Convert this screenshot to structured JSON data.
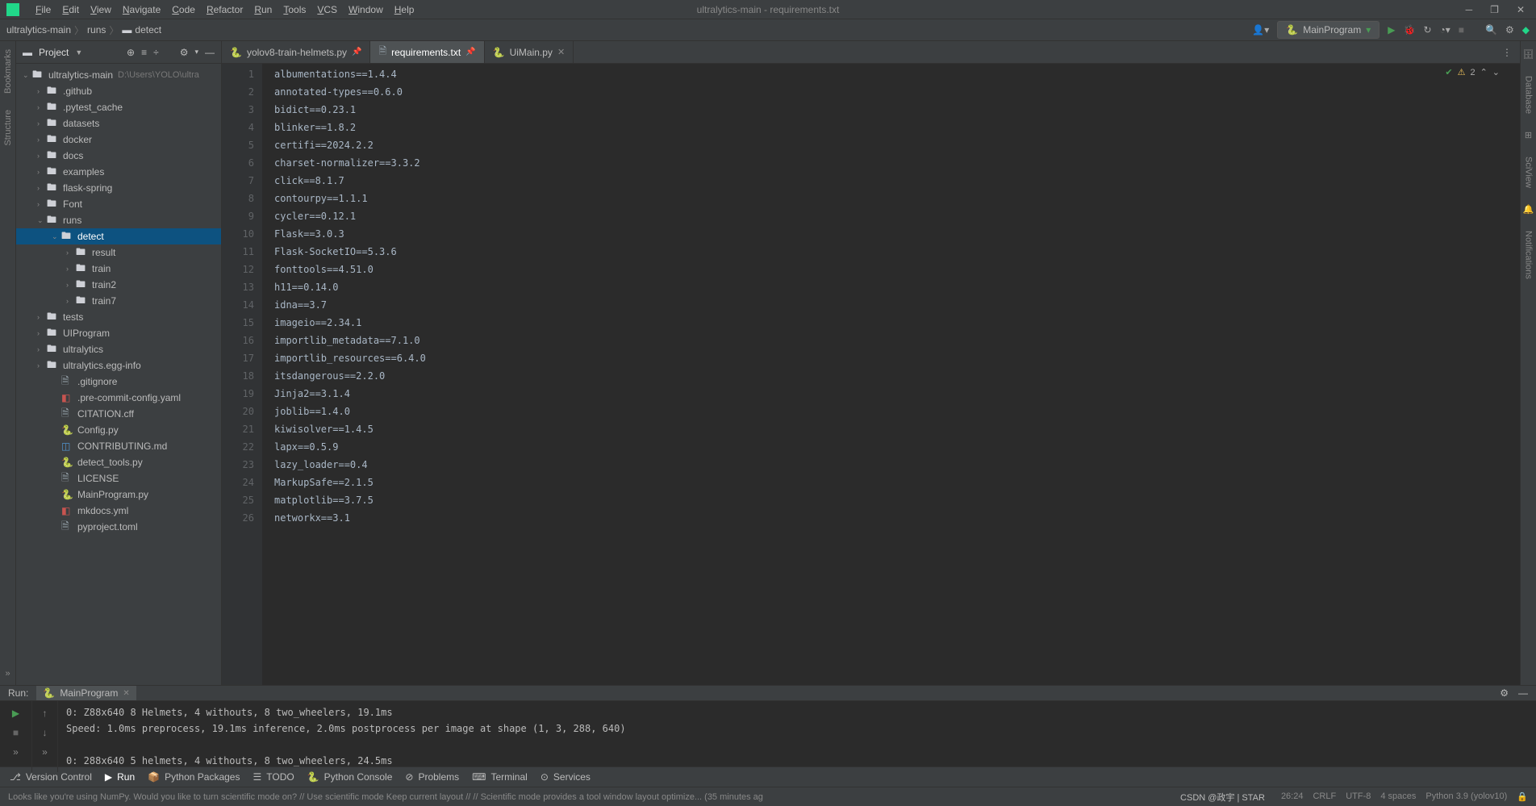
{
  "window": {
    "title": "ultralytics-main - requirements.txt"
  },
  "menu": [
    "File",
    "Edit",
    "View",
    "Navigate",
    "Code",
    "Refactor",
    "Run",
    "Tools",
    "VCS",
    "Window",
    "Help"
  ],
  "breadcrumb": [
    "ultralytics-main",
    "runs",
    "detect"
  ],
  "runConfig": "MainProgram",
  "projectPanel": {
    "label": "Project"
  },
  "tree": [
    {
      "depth": 0,
      "arrow": "v",
      "type": "folder",
      "name": "ultralytics-main",
      "path": "D:\\Users\\YOLO\\ultra"
    },
    {
      "depth": 1,
      "arrow": ">",
      "type": "folder",
      "name": ".github"
    },
    {
      "depth": 1,
      "arrow": ">",
      "type": "folder",
      "name": ".pytest_cache"
    },
    {
      "depth": 1,
      "arrow": ">",
      "type": "folder",
      "name": "datasets"
    },
    {
      "depth": 1,
      "arrow": ">",
      "type": "folder",
      "name": "docker"
    },
    {
      "depth": 1,
      "arrow": ">",
      "type": "folder",
      "name": "docs"
    },
    {
      "depth": 1,
      "arrow": ">",
      "type": "folder",
      "name": "examples"
    },
    {
      "depth": 1,
      "arrow": ">",
      "type": "folder",
      "name": "flask-spring"
    },
    {
      "depth": 1,
      "arrow": ">",
      "type": "folder",
      "name": "Font"
    },
    {
      "depth": 1,
      "arrow": "v",
      "type": "folder",
      "name": "runs"
    },
    {
      "depth": 2,
      "arrow": "v",
      "type": "folder",
      "name": "detect",
      "selected": true
    },
    {
      "depth": 3,
      "arrow": ">",
      "type": "folder",
      "name": "result"
    },
    {
      "depth": 3,
      "arrow": ">",
      "type": "folder",
      "name": "train"
    },
    {
      "depth": 3,
      "arrow": ">",
      "type": "folder",
      "name": "train2"
    },
    {
      "depth": 3,
      "arrow": ">",
      "type": "folder",
      "name": "train7"
    },
    {
      "depth": 1,
      "arrow": ">",
      "type": "folder",
      "name": "tests"
    },
    {
      "depth": 1,
      "arrow": ">",
      "type": "folder",
      "name": "UIProgram"
    },
    {
      "depth": 1,
      "arrow": ">",
      "type": "folder",
      "name": "ultralytics"
    },
    {
      "depth": 1,
      "arrow": ">",
      "type": "folder",
      "name": "ultralytics.egg-info"
    },
    {
      "depth": 2,
      "arrow": "",
      "type": "file",
      "name": ".gitignore",
      "icon": "txt"
    },
    {
      "depth": 2,
      "arrow": "",
      "type": "file",
      "name": ".pre-commit-config.yaml",
      "icon": "yaml"
    },
    {
      "depth": 2,
      "arrow": "",
      "type": "file",
      "name": "CITATION.cff",
      "icon": "txt"
    },
    {
      "depth": 2,
      "arrow": "",
      "type": "file",
      "name": "Config.py",
      "icon": "py"
    },
    {
      "depth": 2,
      "arrow": "",
      "type": "file",
      "name": "CONTRIBUTING.md",
      "icon": "md"
    },
    {
      "depth": 2,
      "arrow": "",
      "type": "file",
      "name": "detect_tools.py",
      "icon": "py"
    },
    {
      "depth": 2,
      "arrow": "",
      "type": "file",
      "name": "LICENSE",
      "icon": "txt"
    },
    {
      "depth": 2,
      "arrow": "",
      "type": "file",
      "name": "MainProgram.py",
      "icon": "py"
    },
    {
      "depth": 2,
      "arrow": "",
      "type": "file",
      "name": "mkdocs.yml",
      "icon": "yaml"
    },
    {
      "depth": 2,
      "arrow": "",
      "type": "file",
      "name": "pyproject.toml",
      "icon": "txt"
    }
  ],
  "tabs": [
    {
      "name": "yolov8-train-helmets.py",
      "icon": "py",
      "active": false,
      "pinned": true
    },
    {
      "name": "requirements.txt",
      "icon": "txt",
      "active": true,
      "pinned": true
    },
    {
      "name": "UiMain.py",
      "icon": "py",
      "active": false,
      "pinned": false
    }
  ],
  "editorWarnings": "2",
  "code": [
    "albumentations==1.4.4",
    "annotated-types==0.6.0",
    "bidict==0.23.1",
    "blinker==1.8.2",
    "certifi==2024.2.2",
    "charset-normalizer==3.3.2",
    "click==8.1.7",
    "contourpy==1.1.1",
    "cycler==0.12.1",
    "Flask==3.0.3",
    "Flask-SocketIO==5.3.6",
    "fonttools==4.51.0",
    "h11==0.14.0",
    "idna==3.7",
    "imageio==2.34.1",
    "importlib_metadata==7.1.0",
    "importlib_resources==6.4.0",
    "itsdangerous==2.2.0",
    "Jinja2==3.1.4",
    "joblib==1.4.0",
    "kiwisolver==1.4.5",
    "lapx==0.5.9",
    "lazy_loader==0.4",
    "MarkupSafe==2.1.5",
    "matplotlib==3.7.5",
    "networkx==3.1"
  ],
  "runPanel": {
    "label": "Run:",
    "tab": "MainProgram",
    "output": [
      "0: Z88x640 8 Helmets, 4 withouts, 8 two_wheelers, 19.1ms",
      "Speed: 1.0ms preprocess, 19.1ms inference, 2.0ms postprocess per image at shape (1, 3, 288, 640)",
      "",
      "0: 288x640 5 helmets, 4 withouts, 8 two_wheelers, 24.5ms"
    ]
  },
  "bottomToolbar": [
    {
      "icon": "vcs",
      "label": "Version Control"
    },
    {
      "icon": "run",
      "label": "Run",
      "active": true
    },
    {
      "icon": "pkg",
      "label": "Python Packages"
    },
    {
      "icon": "todo",
      "label": "TODO"
    },
    {
      "icon": "pycon",
      "label": "Python Console"
    },
    {
      "icon": "prob",
      "label": "Problems"
    },
    {
      "icon": "term",
      "label": "Terminal"
    },
    {
      "icon": "svc",
      "label": "Services"
    }
  ],
  "statusBar": {
    "left": "Looks like you're using NumPy. Would you like to turn scientific mode on? // Use scientific mode    Keep current layout // // Scientific mode provides a tool window layout optimize... (35 minutes ag",
    "right": [
      "26:24",
      "CRLF",
      "UTF-8",
      "4 spaces",
      "Python 3.9 (yolov10)"
    ],
    "watermark": "CSDN @政宇 | STAR"
  },
  "rightRail": [
    "Database",
    "SciView",
    "Notifications"
  ],
  "leftRail": [
    "Bookmarks",
    "Structure"
  ]
}
